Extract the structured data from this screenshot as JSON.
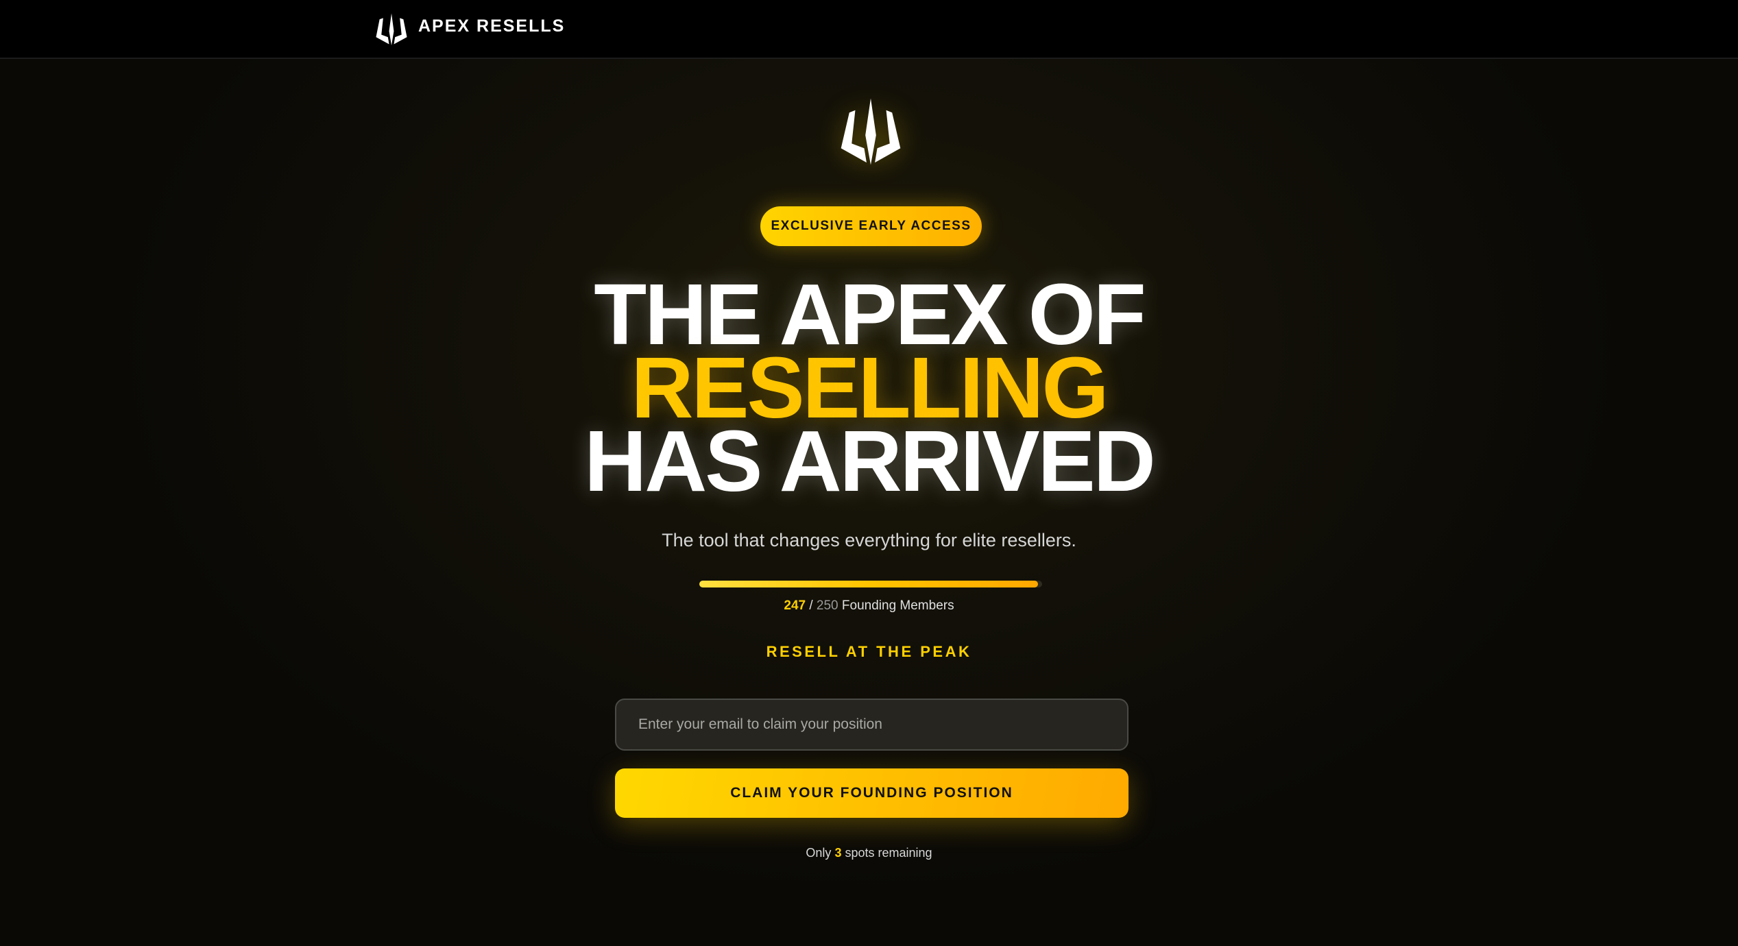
{
  "nav": {
    "brand": "APEX RESELLS",
    "logo_icon": "trident-logo-icon"
  },
  "hero": {
    "badge": "EXCLUSIVE EARLY ACCESS",
    "headline": {
      "line1": "THE APEX OF",
      "line2": "RESELLING",
      "line3": "HAS ARRIVED"
    },
    "subtitle": "The tool that changes everything for elite resellers.",
    "progress": {
      "current": "247",
      "separator": "/",
      "total": "250",
      "label": "Founding Members",
      "fraction": 0.988
    },
    "tagline": "RESELL AT THE PEAK",
    "email": {
      "value": "",
      "placeholder": "Enter your email to claim your position"
    },
    "cta_label": "CLAIM YOUR FOUNDING POSITION",
    "remaining": {
      "prefix": "Only",
      "count": "3",
      "suffix": "spots remaining"
    }
  },
  "colors": {
    "accent": "#ffc400",
    "accent_end": "#ffaa00",
    "background": "#0b0a07"
  }
}
